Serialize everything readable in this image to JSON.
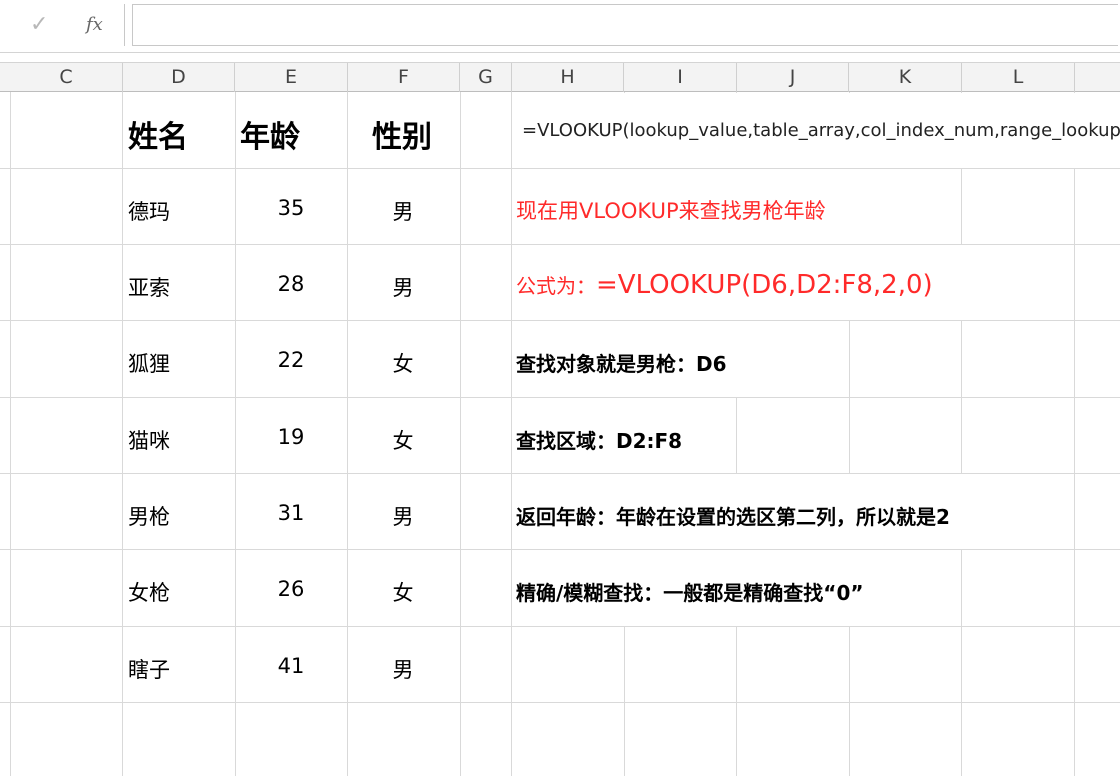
{
  "formula_bar": {
    "check_icon": "check-icon",
    "fx_label": "fx",
    "value": ""
  },
  "columns": [
    "C",
    "D",
    "E",
    "F",
    "G",
    "H",
    "I",
    "J",
    "K",
    "L"
  ],
  "table": {
    "headers": [
      "姓名",
      "年龄",
      "性别"
    ],
    "rows": [
      {
        "name": "德玛",
        "age": "35",
        "gender": "男"
      },
      {
        "name": "亚索",
        "age": "28",
        "gender": "男"
      },
      {
        "name": "狐狸",
        "age": "22",
        "gender": "女"
      },
      {
        "name": "猫咪",
        "age": "19",
        "gender": "女"
      },
      {
        "name": "男枪",
        "age": "31",
        "gender": "男"
      },
      {
        "name": "女枪",
        "age": "26",
        "gender": "女"
      },
      {
        "name": "瞎子",
        "age": "41",
        "gender": "男"
      }
    ]
  },
  "notes": {
    "syntax": "=VLOOKUP(lookup_value,table_array,col_index_num,range_lookup)",
    "intro": "现在用VLOOKUP来查找男枪年龄",
    "formula_prefix": "公式为：",
    "formula": "=VLOOKUP(D6,D2:F8,2,0)",
    "lookup_object": "查找对象就是男枪：D6",
    "lookup_range": "查找区域：D2:F8",
    "return_col": "返回年龄：年龄在设置的选区第二列，所以就是2",
    "match_type": "精确/模糊查找：一般都是精确查找“0”"
  },
  "colors": {
    "red": "#ff2a2a",
    "grid": "#d9d9d9",
    "header_bg": "#f3f3f3"
  }
}
